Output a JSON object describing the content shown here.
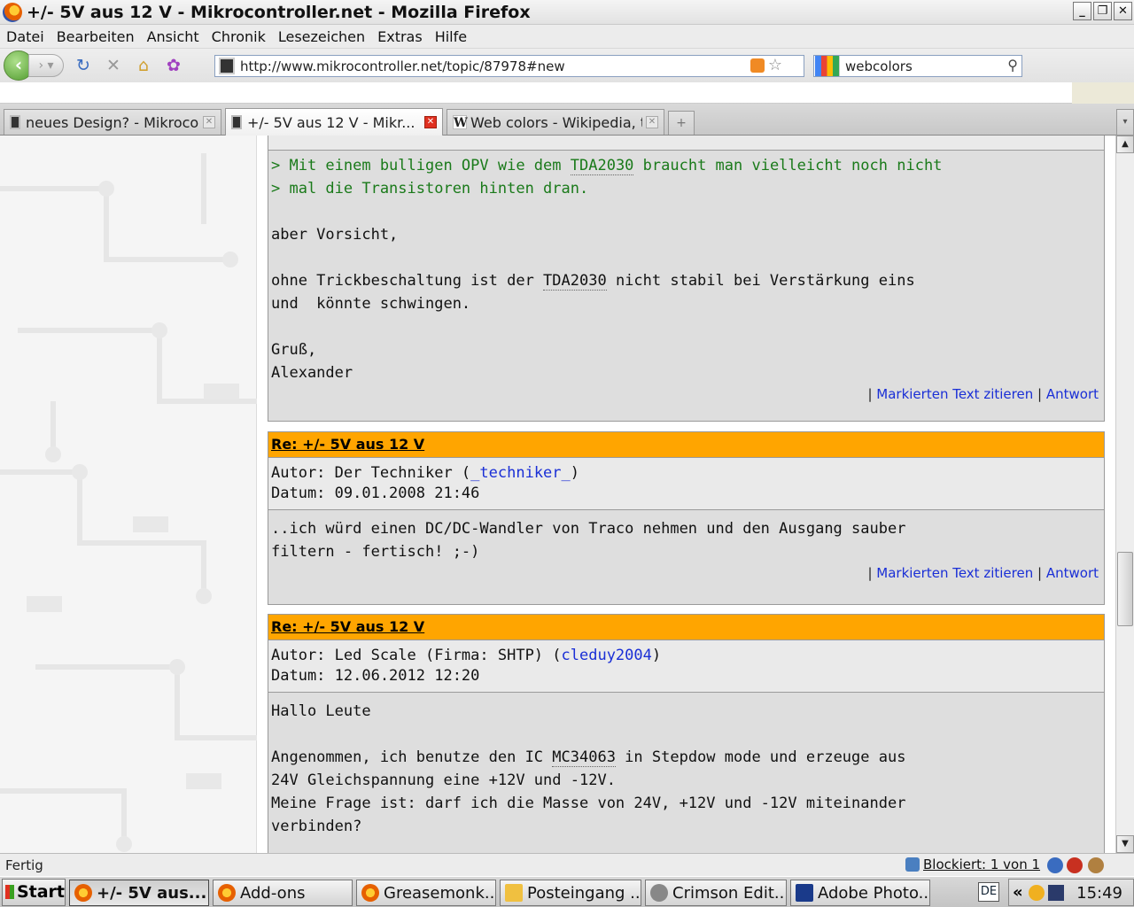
{
  "window": {
    "title": "+/- 5V aus 12 V - Mikrocontroller.net - Mozilla Firefox",
    "minimize": "_",
    "restore": "❐",
    "close": "✕"
  },
  "menu": [
    "Datei",
    "Bearbeiten",
    "Ansicht",
    "Chronik",
    "Lesezeichen",
    "Extras",
    "Hilfe"
  ],
  "navbar": {
    "url": "http://www.mikrocontroller.net/topic/87978#new",
    "search_value": "webcolors"
  },
  "tabs": [
    {
      "label": "neues Design? - Mikrocon...",
      "active": false
    },
    {
      "label": "+/- 5V aus 12 V - Mikr...",
      "active": true
    },
    {
      "label": "Web colors - Wikipedia, t...",
      "active": false
    }
  ],
  "posts": {
    "p1": {
      "quote_1": "> Mit einem bulligen OPV wie dem ",
      "quote_1_abbr": "TDA2030",
      "quote_1_end": " braucht man vielleicht noch nicht",
      "quote_2": "> mal die Transistoren hinten dran.",
      "line_1": "aber Vorsicht,",
      "line_2a": "ohne Trickbeschaltung ist der ",
      "line_2_abbr": "TDA2030",
      "line_2b": " nicht stabil bei Verstärkung eins",
      "line_3": "und  könnte schwingen.",
      "line_4": "Gruß,",
      "line_5": "Alexander"
    },
    "p2": {
      "title": "Re: +/- 5V aus 12 V",
      "author_prefix": "Autor: Der Techniker (",
      "author_link": "_techniker_",
      "author_suffix": ")",
      "date": "Datum: 09.01.2008 21:46",
      "line_1": "..ich würd einen DC/DC-Wandler von Traco nehmen und den Ausgang sauber",
      "line_2": "filtern - fertisch! ;-)"
    },
    "p3": {
      "title": "Re: +/- 5V aus 12 V",
      "author_prefix": "Autor: Led Scale (Firma: SHTP) (",
      "author_link": "cleduy2004",
      "author_suffix": ")",
      "date": "Datum: 12.06.2012 12:20",
      "line_1": "Hallo Leute",
      "line_2a": "Angenommen, ich benutze den IC ",
      "line_2_abbr": "MC34063",
      "line_2b": " in Stepdow mode und erzeuge aus",
      "line_3": "24V Gleichspannung eine +12V und -12V.",
      "line_4": "Meine Frage ist: darf ich die Masse von 24V, +12V und -12V miteinander",
      "line_5": "verbinden?"
    },
    "actions": {
      "sep": "|",
      "quote_link": "Markierten Text zitieren",
      "reply_link": "Antwort"
    }
  },
  "statusbar": {
    "text": "Fertig",
    "blocked": "Blockiert: 1 von 1"
  },
  "taskbar": {
    "start": "Start",
    "items": [
      "+/- 5V aus...",
      "Add-ons",
      "Greasemonk...",
      "Posteingang ...",
      "Crimson Edit...",
      "Adobe Photo..."
    ],
    "lang": "DE",
    "tray_arrow": "«",
    "clock": "15:49"
  },
  "colors": {
    "post_header": "#ffa500",
    "quote_green": "#1a7a1a",
    "link_blue": "#1a2fd6"
  }
}
